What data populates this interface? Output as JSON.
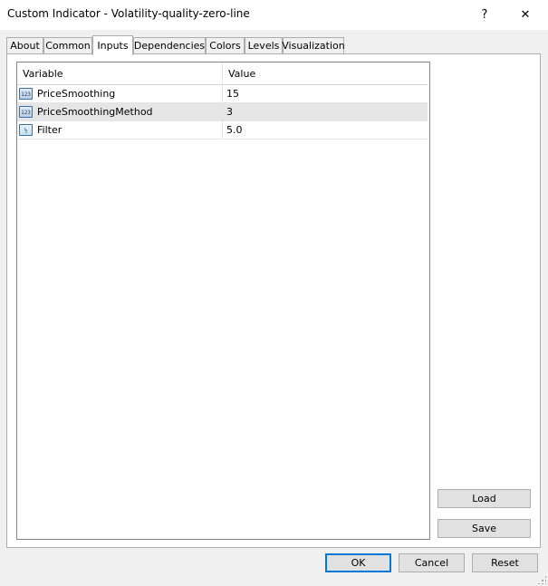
{
  "window": {
    "title": "Custom Indicator - Volatility-quality-zero-line",
    "help_label": "?",
    "close_label": "✕"
  },
  "tabs": [
    {
      "label": "About"
    },
    {
      "label": "Common"
    },
    {
      "label": "Inputs",
      "active": true
    },
    {
      "label": "Dependencies"
    },
    {
      "label": "Colors"
    },
    {
      "label": "Levels"
    },
    {
      "label": "Visualization"
    }
  ],
  "grid": {
    "columns": [
      "Variable",
      "Value"
    ],
    "rows": [
      {
        "variable": "PriceSmoothing",
        "value": "15",
        "type_icon": "123",
        "icon_name": "integer-type-icon",
        "selected": false
      },
      {
        "variable": "PriceSmoothingMethod",
        "value": "3",
        "type_icon": "123",
        "icon_name": "integer-type-icon",
        "selected": true
      },
      {
        "variable": "Filter",
        "value": "5.0",
        "type_icon": "½",
        "icon_name": "double-type-icon",
        "selected": false
      }
    ]
  },
  "side_buttons": {
    "load": "Load",
    "save": "Save"
  },
  "footer_buttons": {
    "ok": "OK",
    "cancel": "Cancel",
    "reset": "Reset"
  }
}
